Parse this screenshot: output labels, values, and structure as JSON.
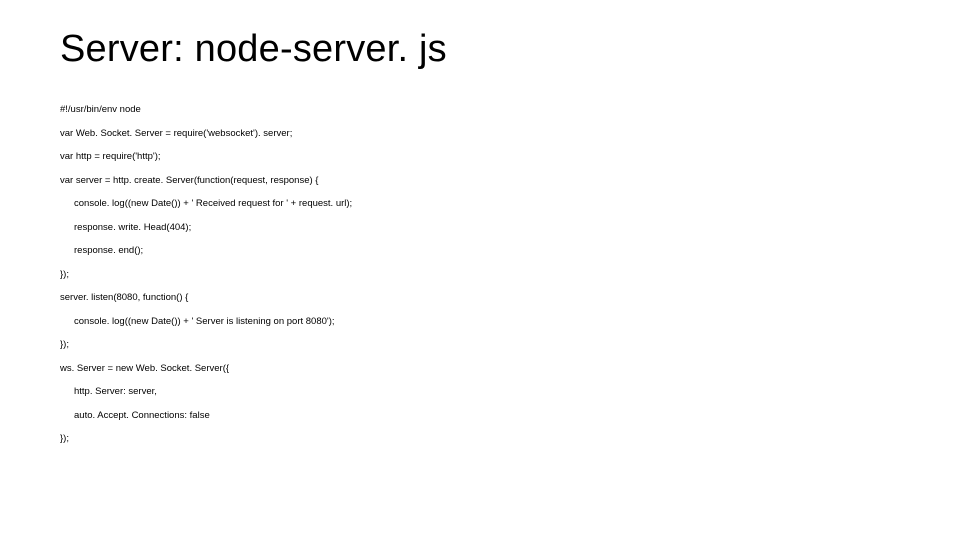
{
  "title": "Server: node-server. js",
  "code": {
    "lines": [
      {
        "indent": 0,
        "text": "#!/usr/bin/env node"
      },
      {
        "indent": 0,
        "text": "var Web. Socket. Server = require('websocket'). server;"
      },
      {
        "indent": 0,
        "text": "var http = require('http');"
      },
      {
        "indent": 0,
        "text": "var server = http. create. Server(function(request, response) {"
      },
      {
        "indent": 1,
        "text": "console. log((new Date()) + ' Received request for ' + request. url);"
      },
      {
        "indent": 1,
        "text": "response. write. Head(404);"
      },
      {
        "indent": 1,
        "text": "response. end();"
      },
      {
        "indent": 0,
        "text": "});"
      },
      {
        "indent": 0,
        "text": "server. listen(8080, function() {"
      },
      {
        "indent": 1,
        "text": "console. log((new Date()) + ' Server is listening on port 8080');"
      },
      {
        "indent": 0,
        "text": "});"
      },
      {
        "indent": 0,
        "text": "ws. Server = new Web. Socket. Server({"
      },
      {
        "indent": 1,
        "text": "http. Server: server,"
      },
      {
        "indent": 1,
        "text": "auto. Accept. Connections: false"
      },
      {
        "indent": 0,
        "text": "});"
      }
    ]
  }
}
